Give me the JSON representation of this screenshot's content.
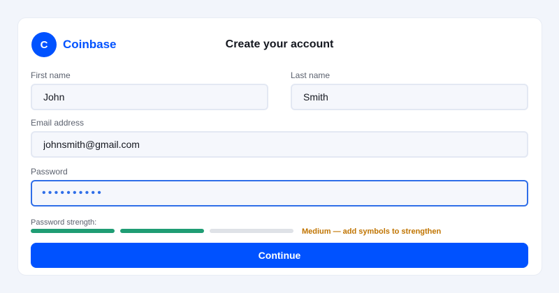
{
  "brand": {
    "logo_letter": "C",
    "name": "Coinbase"
  },
  "header": {
    "title": "Create your account"
  },
  "form": {
    "first_name": {
      "label": "First name",
      "value": "John"
    },
    "last_name": {
      "label": "Last name",
      "value": "Smith"
    },
    "email": {
      "label": "Email address",
      "value": "johnsmith@gmail.com"
    },
    "password": {
      "label": "Password",
      "masked_value": "••••••••••",
      "length": 10
    }
  },
  "strength": {
    "label": "Password strength:",
    "level_filled": 2,
    "level_total": 3,
    "message": "Medium — add symbols to strengthen"
  },
  "actions": {
    "continue_label": "Continue"
  },
  "colors": {
    "brand": "#0052ff",
    "focus": "#2f6ee8",
    "strength_filled": "#1f9d74",
    "strength_empty": "#dfe2e7",
    "strength_message": "#c07400",
    "button": "#0052ff"
  }
}
